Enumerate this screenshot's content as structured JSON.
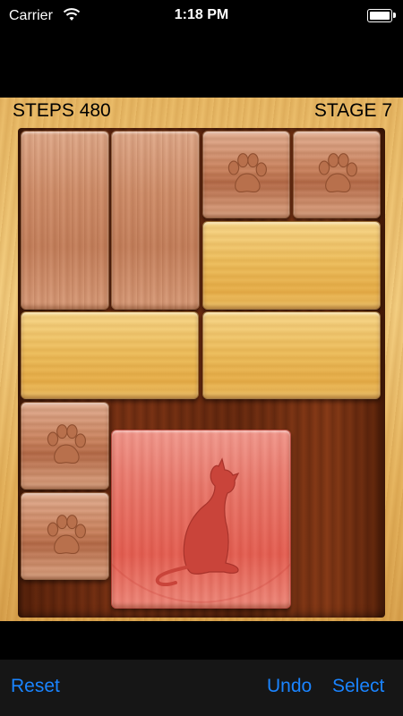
{
  "status_bar": {
    "carrier": "Carrier",
    "time": "1:18 PM",
    "icons": [
      "wifi-icon",
      "battery-icon"
    ]
  },
  "game": {
    "steps_label": "STEPS 480",
    "stage_label": "STAGE 7",
    "blocks": [
      {
        "type": "vertical-2x1",
        "color": "pink"
      },
      {
        "type": "vertical-2x1",
        "color": "pink"
      },
      {
        "type": "single-paw",
        "color": "pink"
      },
      {
        "type": "single-paw",
        "color": "pink"
      },
      {
        "type": "horizontal-1x2",
        "color": "yellow"
      },
      {
        "type": "horizontal-1x2",
        "color": "yellow"
      },
      {
        "type": "horizontal-1x2",
        "color": "yellow"
      },
      {
        "type": "single-paw",
        "color": "pink"
      },
      {
        "type": "single-paw",
        "color": "pink"
      },
      {
        "type": "cat-2x2",
        "color": "red"
      }
    ],
    "colors": {
      "cat_block": "#e8736a",
      "tray": "#6a2b10",
      "frame": "#f0c878"
    }
  },
  "toolbar": {
    "reset_label": "Reset",
    "undo_label": "Undo",
    "select_label": "Select",
    "accent_color": "#1a84ff"
  }
}
